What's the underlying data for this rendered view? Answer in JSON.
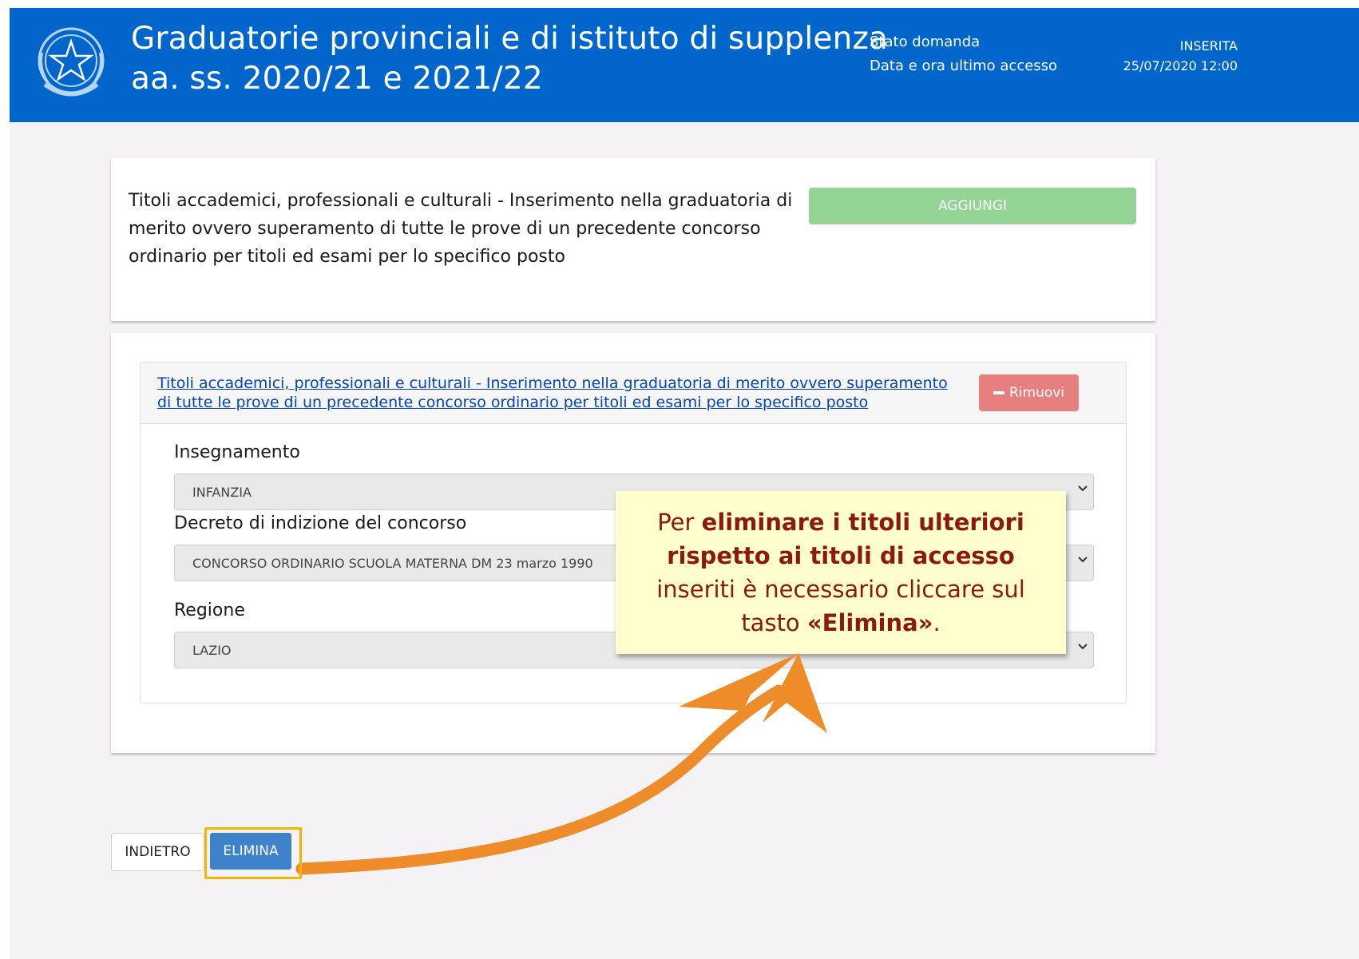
{
  "header": {
    "title_line1": "Graduatorie provinciali e di istituto di supplenza",
    "title_line2": "aa. ss. 2020/21 e 2021/22",
    "status_label": "Stato domanda",
    "status_value": "INSERITA",
    "access_label": "Data e ora ultimo accesso",
    "access_value": "25/07/2020 12:00",
    "emblem_icon": "italian-republic-emblem-icon"
  },
  "section": {
    "text": "Titoli accademici, professionali e culturali - Inserimento nella graduatoria di merito ovvero superamento di tutte le prove di un precedente concorso ordinario per titoli ed esami per lo specifico posto",
    "add_label": "AGGIUNGI"
  },
  "entry": {
    "link_text": "Titoli accademici, professionali e culturali - Inserimento nella graduatoria di merito ovvero superamento di tutte le prove di un precedente concorso ordinario per titoli ed esami per lo specifico posto",
    "remove_label": "Rimuovi",
    "fields": [
      {
        "label": "Insegnamento",
        "value": "INFANZIA"
      },
      {
        "label": "Decreto di indizione del concorso",
        "value": "CONCORSO ORDINARIO SCUOLA MATERNA DM 23 marzo 1990"
      },
      {
        "label": "Regione",
        "value": "LAZIO"
      }
    ]
  },
  "callout": {
    "part1": "Per ",
    "bold1": "eliminare i titoli ulteriori rispetto ai titoli di accesso",
    "part2": " inseriti è necessario cliccare sul tasto ",
    "bold2": "«Elimina»",
    "part3": "."
  },
  "footer": {
    "back_label": "INDIETRO",
    "delete_label": "ELIMINA"
  },
  "colors": {
    "header_bg": "#0066cc",
    "add_button": "#93d393",
    "remove_button": "#e77f7f",
    "delete_button": "#3e82cc",
    "highlight": "#f5b400",
    "arrow": "#ef8c2a",
    "callout_bg": "#ffffce",
    "callout_text": "#8b1a0a"
  }
}
